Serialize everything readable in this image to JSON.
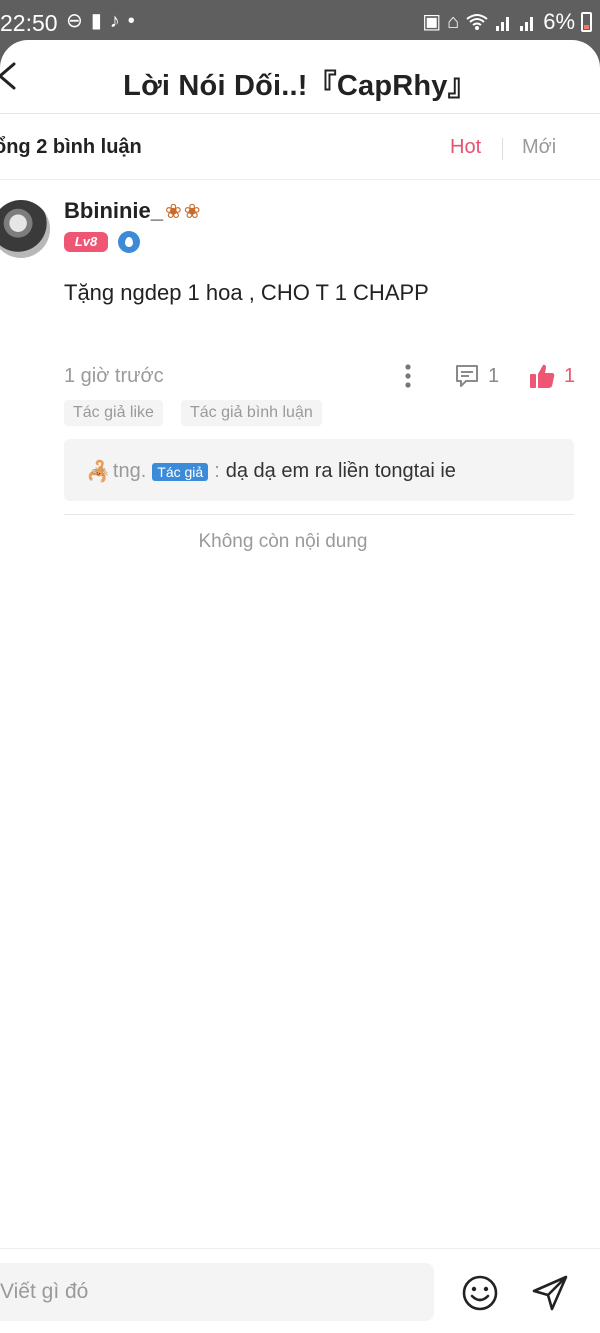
{
  "status_bar": {
    "time": "22:50",
    "battery": "6%",
    "left_icons": [
      "do-not-disturb-icon",
      "alert-icon",
      "tiktok-icon",
      "dot-icon"
    ],
    "right_icons": [
      "lock-icon",
      "sleep-icon",
      "wifi-icon",
      "signal-icon",
      "signal-icon",
      "battery-icon"
    ]
  },
  "header": {
    "title": "Lời Nói Dối..!『CapRhy』"
  },
  "comments_bar": {
    "count_label": "ổng 2 bình luận",
    "sort_hot": "Hot",
    "sort_new": "Mới",
    "active_sort": "Hot"
  },
  "comment": {
    "username": "Bbininie_",
    "level": "Lv8",
    "text": "Tặng ngdep 1 hoa , CHO T 1 CHAPP",
    "time_ago": "1 giờ trước",
    "reply_count": "1",
    "like_count": "1",
    "tags": [
      "Tác giả like",
      "Tác giả bình luận"
    ],
    "reply": {
      "name": "tng.",
      "author_badge": "Tác giả",
      "separator": ":",
      "text": "dạ dạ em ra liền tongtai ie"
    }
  },
  "end_message": "Không còn nội dung",
  "composer": {
    "placeholder": "Viết gì đó"
  },
  "colors": {
    "accent": "#ee5673",
    "badge_blue": "#3c8bd8",
    "muted": "#9a9a9a"
  }
}
